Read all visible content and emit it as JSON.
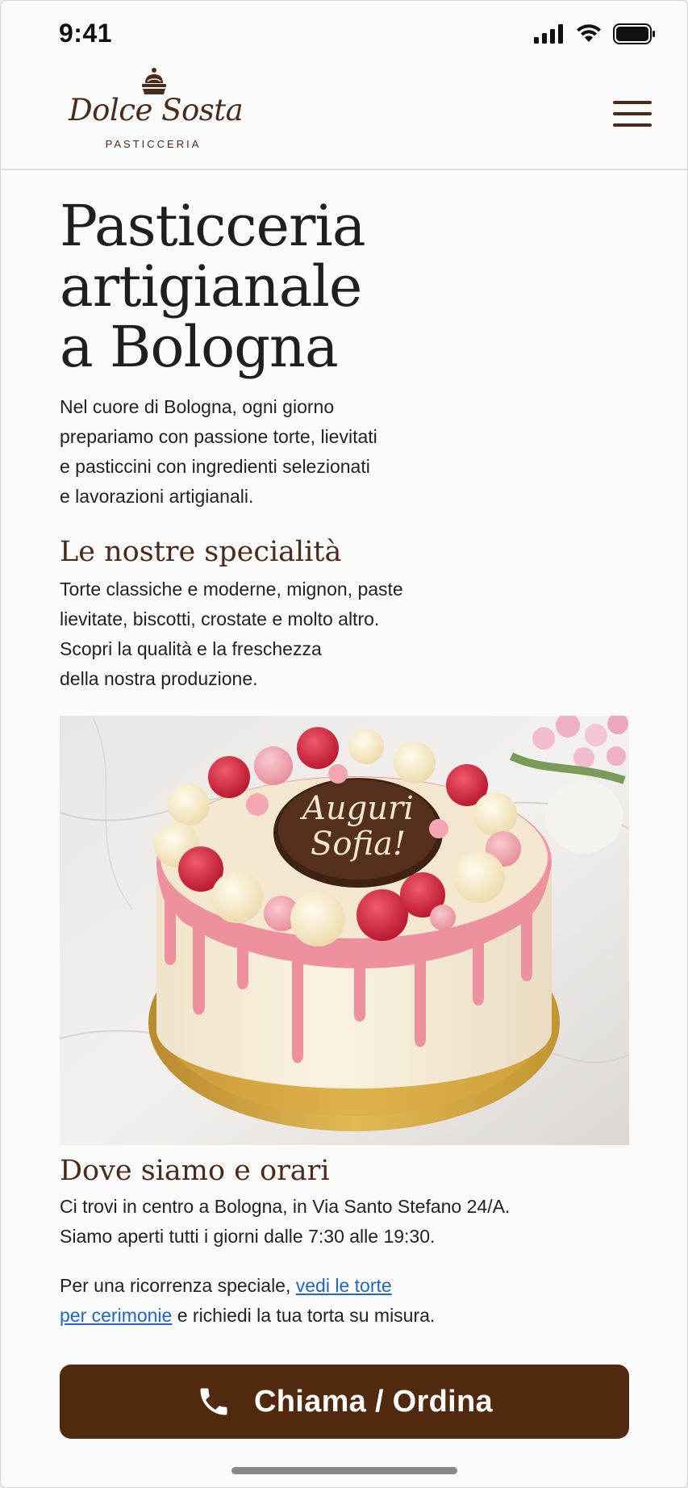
{
  "status_bar": {
    "time": "9:41",
    "icons": [
      "signal-icon",
      "wifi-icon",
      "battery-icon"
    ]
  },
  "header": {
    "logo_name": "Dolce Sosta",
    "logo_sub": "PASTICCERIA",
    "menu_icon": "hamburger-menu-icon"
  },
  "hero": {
    "title": "Pasticceria\nartigianale\na Bologna",
    "intro": "Nel cuore di Bologna, ogni giorno\nprepariamo con passione torte, lievitati\ne pasticcini con ingredienti selezionati\ne lavorazioni artigianali."
  },
  "specialties": {
    "title": "Le nostre specialità",
    "text": "Torte classiche e moderne, mignon, paste\nlievitate, biscotti, crostate e molto altro.\nScopri la qualità e la freschezza\ndella nostra produzione."
  },
  "cake_image": {
    "plaque_line1": "Auguri",
    "plaque_line2": "Sofia!"
  },
  "location": {
    "title": "Dove siamo e orari",
    "text": "Ci trovi in centro a Bologna, in Via Santo Stefano 24/A.\nSiamo aperti tutti i giorni dalle 7:30 alle 19:30.",
    "occasion_before": "Per una ricorrenza speciale, ",
    "occasion_link_1": "vedi le torte",
    "occasion_link_2": "per cerimonie",
    "occasion_after": " e richiedi la tua torta su misura."
  },
  "cta": {
    "label": "Chiama / Ordina",
    "icon": "phone-icon"
  },
  "colors": {
    "brand_brown": "#51290f",
    "link_blue": "#1f66c9",
    "text_dark": "#1f1f1f"
  }
}
